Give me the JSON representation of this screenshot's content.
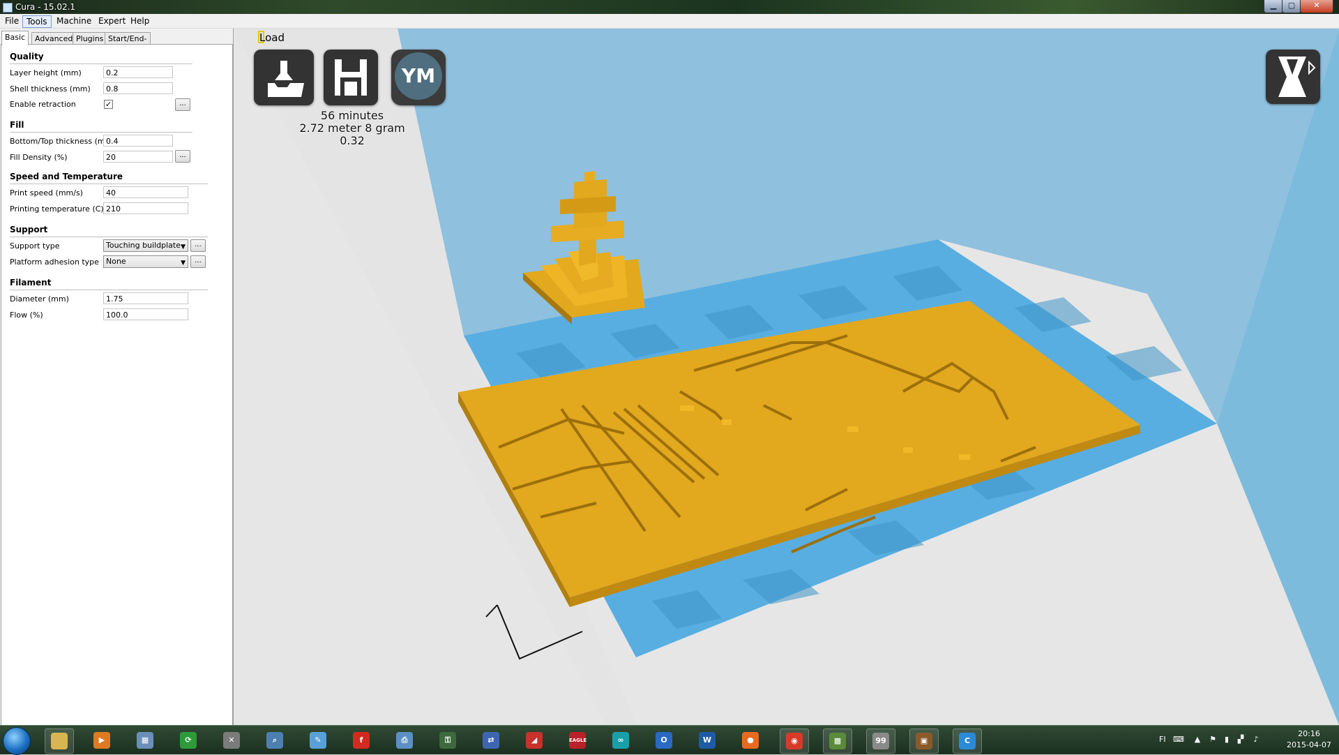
{
  "window": {
    "title": "Cura - 15.02.1"
  },
  "menu": [
    "File",
    "Tools",
    "Machine",
    "Expert",
    "Help"
  ],
  "tabs": [
    "Basic",
    "Advanced",
    "Plugins",
    "Start/End-GCode"
  ],
  "sections": {
    "quality": {
      "title": "Quality",
      "layer_height_label": "Layer height (mm)",
      "layer_height": "0.2",
      "shell_thickness_label": "Shell thickness (mm)",
      "shell_thickness": "0.8",
      "retraction_label": "Enable retraction",
      "retraction_checked": "✓"
    },
    "fill": {
      "title": "Fill",
      "bottom_top_label": "Bottom/Top thickness (mm)",
      "bottom_top": "0.4",
      "fill_density_label": "Fill Density (%)",
      "fill_density": "20"
    },
    "speed": {
      "title": "Speed and Temperature",
      "print_speed_label": "Print speed (mm/s)",
      "print_speed": "40",
      "temperature_label": "Printing temperature (C)",
      "temperature": "210"
    },
    "support": {
      "title": "Support",
      "support_type_label": "Support type",
      "support_type": "Touching buildplate",
      "adhesion_label": "Platform adhesion type",
      "adhesion": "None"
    },
    "filament": {
      "title": "Filament",
      "diameter_label": "Diameter (mm)",
      "diameter": "1.75",
      "flow_label": "Flow (%)",
      "flow": "100.0"
    }
  },
  "ellipsis": "...",
  "viewport": {
    "load_label": "Load",
    "ym_label": "YM",
    "print_time": "56 minutes",
    "material": "2.72 meter 8 gram",
    "cost": "0.32"
  },
  "taskbar": {
    "lang": "FI",
    "time": "20:16",
    "date": "2015-04-07",
    "apps": [
      {
        "name": "explorer",
        "label": "",
        "color": "#d9b552"
      },
      {
        "name": "media-player",
        "label": "▶",
        "color": "#e07a22"
      },
      {
        "name": "calculator",
        "label": "▦",
        "color": "#6b8fb8"
      },
      {
        "name": "sync",
        "label": "⟳",
        "color": "#2e9a3a"
      },
      {
        "name": "tools",
        "label": "✕",
        "color": "#7b7b7b"
      },
      {
        "name": "search",
        "label": "⌕",
        "color": "#4d7fb0"
      },
      {
        "name": "notes",
        "label": "✎",
        "color": "#5aa0d8"
      },
      {
        "name": "foxit",
        "label": "f",
        "color": "#d22a1e"
      },
      {
        "name": "printer",
        "label": "⎙",
        "color": "#5c8fc4"
      },
      {
        "name": "lock",
        "label": "⚿",
        "color": "#3c6a3c"
      },
      {
        "name": "network",
        "label": "⇄",
        "color": "#3e66b0"
      },
      {
        "name": "sketchup",
        "label": "◢",
        "color": "#c8322a"
      },
      {
        "name": "eagle",
        "label": "EAGLE",
        "color": "#b8222a"
      },
      {
        "name": "arduino",
        "label": "∞",
        "color": "#1a9fa8"
      },
      {
        "name": "outlook",
        "label": "O",
        "color": "#2a6ac4"
      },
      {
        "name": "word",
        "label": "W",
        "color": "#1f5aa6"
      },
      {
        "name": "firefox",
        "label": "●",
        "color": "#e86a1e"
      },
      {
        "name": "chrome",
        "label": "◉",
        "color": "#d83a2a"
      },
      {
        "name": "minecraft",
        "label": "▩",
        "color": "#5a8a3a"
      },
      {
        "name": "computer",
        "label": "99",
        "color": "#8a8a8a"
      },
      {
        "name": "crate",
        "label": "▣",
        "color": "#8a5a2a"
      },
      {
        "name": "cura",
        "label": "C",
        "color": "#2a8ad8"
      }
    ]
  }
}
